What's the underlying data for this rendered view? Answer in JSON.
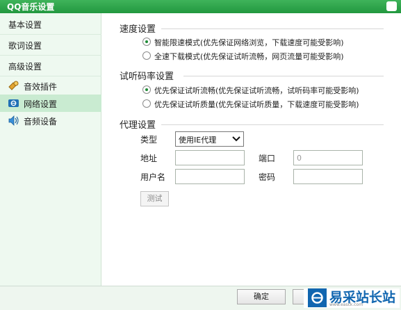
{
  "window": {
    "title": "QQ音乐设置"
  },
  "sidebar": {
    "items": [
      {
        "label": "基本设置"
      },
      {
        "label": "歌词设置"
      },
      {
        "label": "高级设置"
      }
    ],
    "subitems": [
      {
        "label": "音效插件",
        "icon": "effects-plugin-icon"
      },
      {
        "label": "网络设置",
        "icon": "network-icon"
      },
      {
        "label": "音频设备",
        "icon": "audio-device-icon"
      }
    ],
    "active": "网络设置"
  },
  "speed": {
    "title": "速度设置",
    "options": [
      "智能限速模式(优先保证网络浏览，下载速度可能受影响)",
      "全速下载模式(优先保证试听流畅，网页流量可能受影响)"
    ],
    "selected": 0
  },
  "bitrate": {
    "title": "试听码率设置",
    "options": [
      "优先保证试听流畅(优先保证试听流畅，试听码率可能受影响)",
      "优先保证试听质量(优先保证试听质量，下载速度可能受影响)"
    ],
    "selected": 0
  },
  "proxy": {
    "title": "代理设置",
    "type_label": "类型",
    "type_value": "使用IE代理",
    "address_label": "地址",
    "address_value": "",
    "port_label": "端口",
    "port_value": "0",
    "username_label": "用户名",
    "username_value": "",
    "password_label": "密码",
    "password_value": "",
    "test_button": "测试"
  },
  "footer": {
    "ok_button": "确定"
  },
  "watermark": {
    "text": "易采站长站",
    "url": "www.easck.com"
  },
  "colors": {
    "title_bar": "#22983f",
    "sidebar_bg": "#eef9f0",
    "active_item": "#c9ebd1",
    "watermark": "#1166b0"
  }
}
